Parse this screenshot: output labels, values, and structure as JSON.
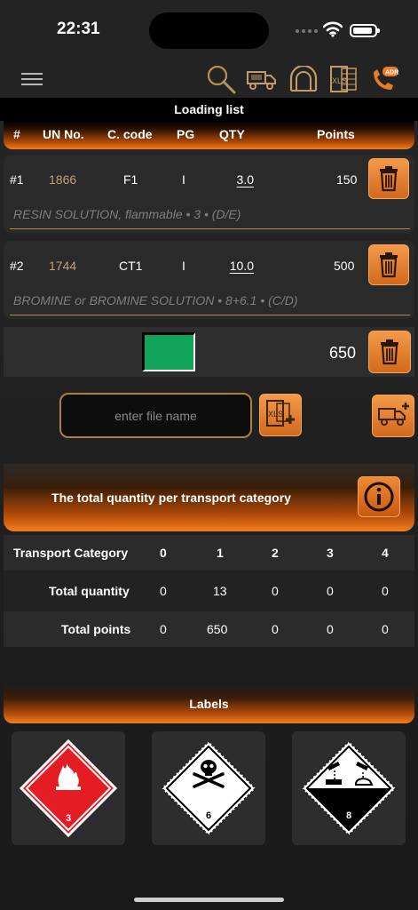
{
  "status_bar": {
    "time": "22:31"
  },
  "nav": {
    "icons": [
      "menu-icon",
      "search-icon",
      "truck-icon",
      "tunnel-icon",
      "xls-icon",
      "adr-phone-icon"
    ],
    "adr_label": "ADR",
    "xls_label": "XLS"
  },
  "loading_list": {
    "title": "Loading list",
    "columns": [
      "#",
      "UN No.",
      "C. code",
      "PG",
      "QTY",
      "Points"
    ],
    "items": [
      {
        "index": "#1",
        "un": "1866",
        "code": "F1",
        "pg": "I",
        "qty": "3.0",
        "points": "150",
        "description": "RESIN SOLUTION, flammable • 3 • (D/E)"
      },
      {
        "index": "#2",
        "un": "1744",
        "code": "CT1",
        "pg": "I",
        "qty": "10.0",
        "points": "500",
        "description": "BROMINE or BROMINE SOLUTION • 8+6.1 • (C/D)"
      }
    ],
    "total_points": "650",
    "status_color": "#10a35a"
  },
  "file": {
    "placeholder": "enter file name"
  },
  "transport": {
    "title": "The total quantity per transport category",
    "row_labels": [
      "Transport Category",
      "Total quantity",
      "Total points"
    ],
    "categories": [
      "0",
      "1",
      "2",
      "3",
      "4"
    ],
    "quantities": [
      "0",
      "13",
      "0",
      "0",
      "0"
    ],
    "points": [
      "0",
      "650",
      "0",
      "0",
      "0"
    ]
  },
  "labels": {
    "title": "Labels",
    "items": [
      {
        "number": "3",
        "name": "flammable-liquid-label",
        "color": "#e31d23"
      },
      {
        "number": "6",
        "name": "toxic-label",
        "color": "#ffffff"
      },
      {
        "number": "8",
        "name": "corrosive-label",
        "color": "#ffffff"
      }
    ]
  },
  "colors": {
    "accent": "#f2801e",
    "un_text": "#c3a079",
    "underline": "#b2884d"
  }
}
